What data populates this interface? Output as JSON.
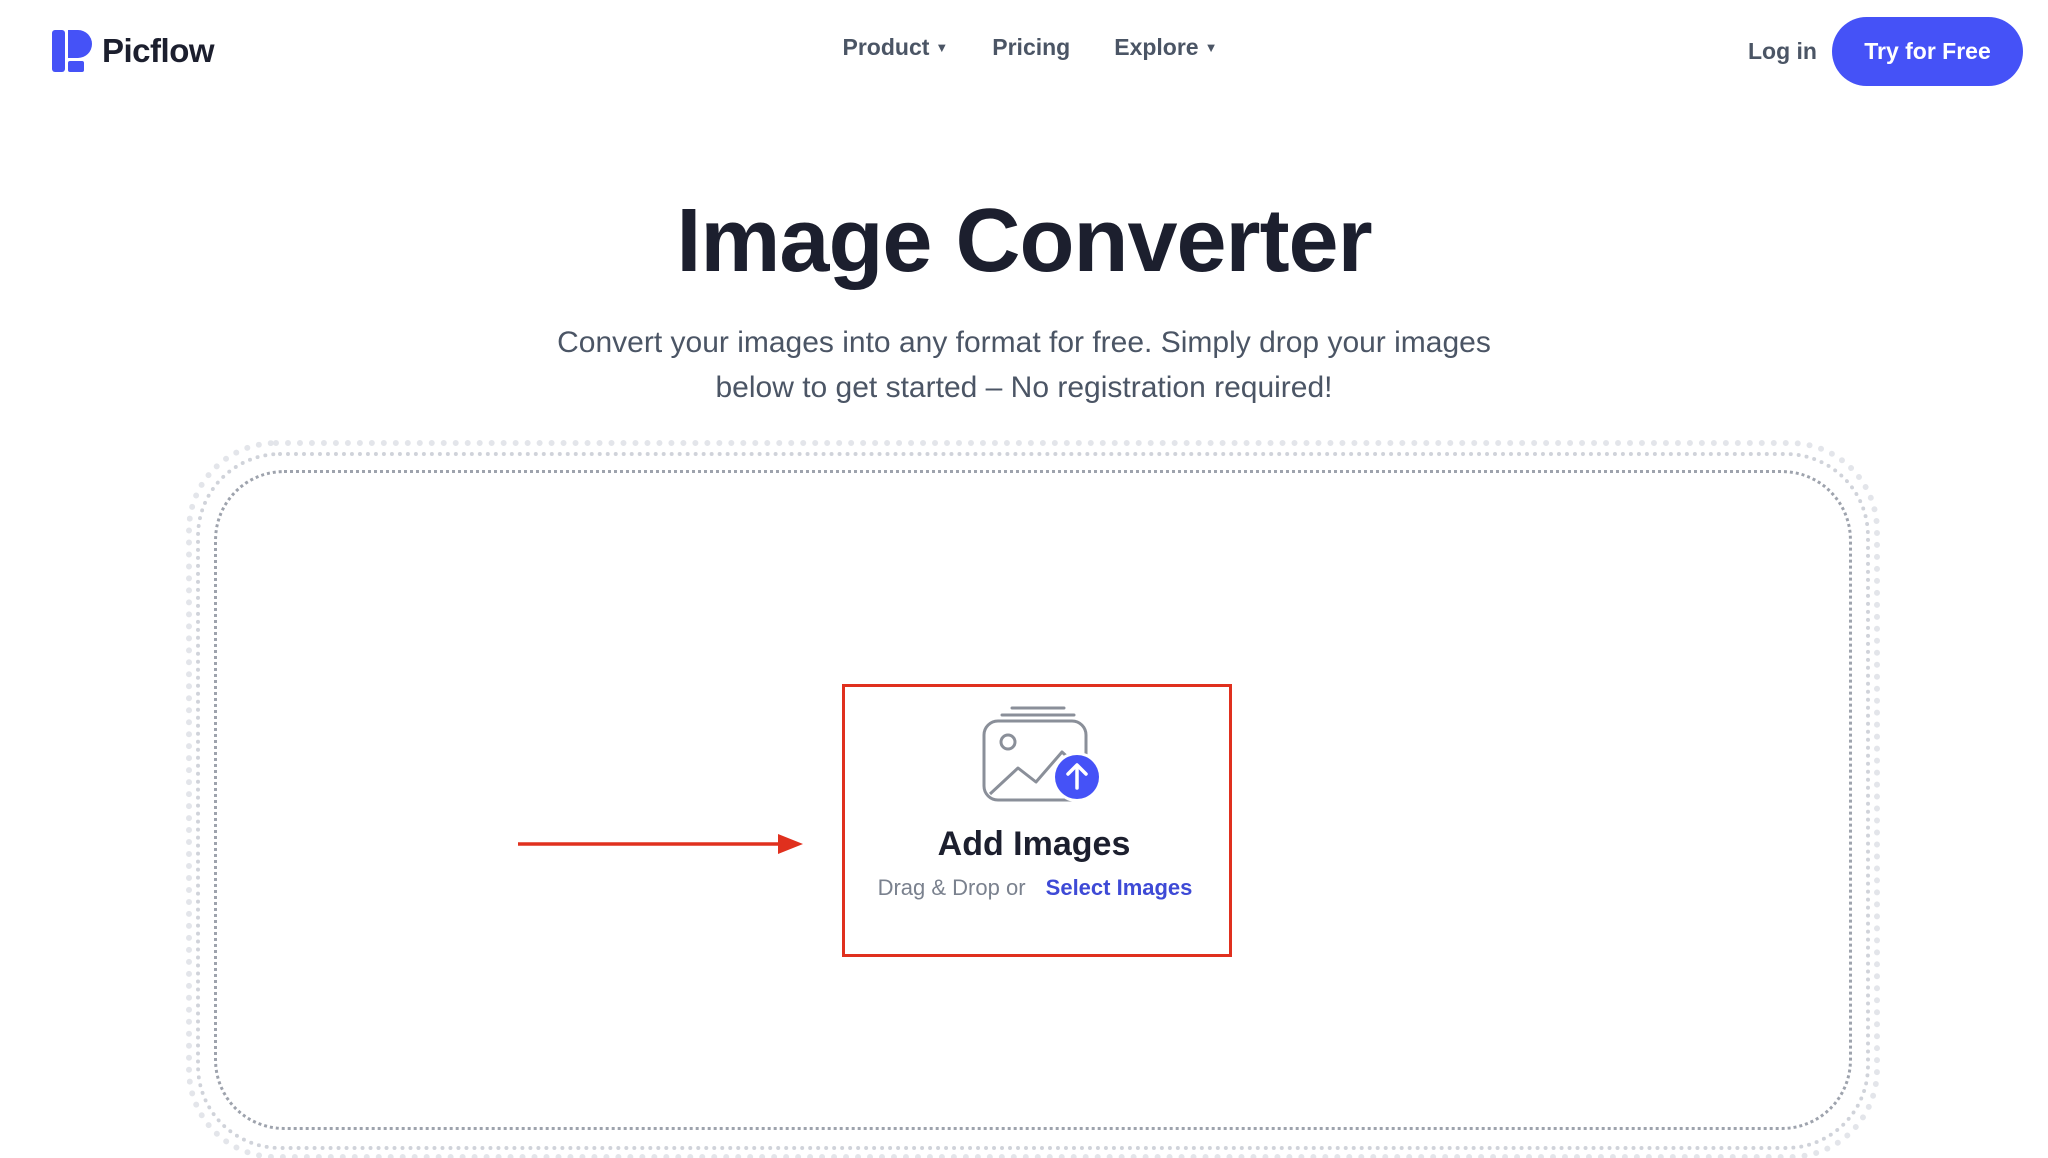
{
  "header": {
    "brand": "Picflow",
    "nav": [
      {
        "label": "Product",
        "has_dropdown": true
      },
      {
        "label": "Pricing",
        "has_dropdown": false
      },
      {
        "label": "Explore",
        "has_dropdown": true
      }
    ],
    "login_label": "Log in",
    "cta_label": "Try for Free"
  },
  "hero": {
    "title": "Image Converter",
    "subtitle_line1": "Convert your images into any format for free. Simply drop your images",
    "subtitle_line2": "below to get started – No registration required!"
  },
  "dropzone": {
    "icon": "image-upload-icon",
    "title": "Add Images",
    "drag_text": "Drag & Drop or",
    "select_label": "Select Images"
  },
  "colors": {
    "accent": "#4552f7",
    "link": "#3e4ad6",
    "annotation": "#e0301e",
    "text_dark": "#1c1f2e",
    "text_muted": "#4b5565"
  }
}
